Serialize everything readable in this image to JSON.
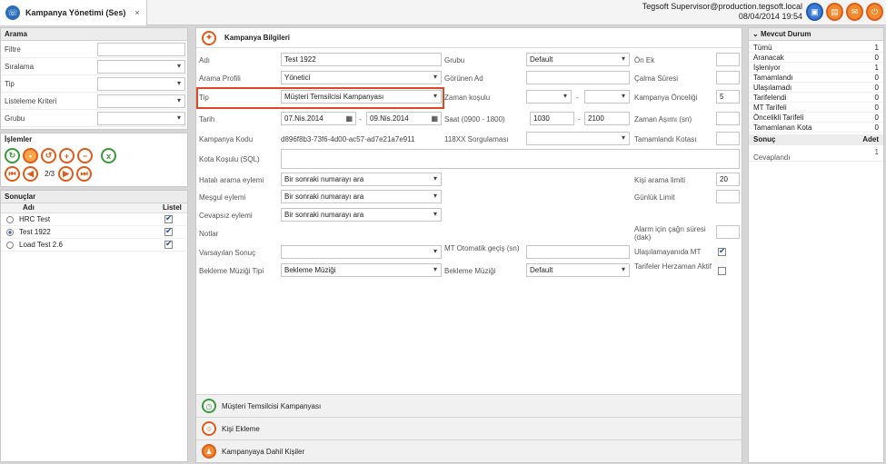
{
  "tab": {
    "title": "Kampanya Yönetimi (Ses)",
    "close": "×",
    "logo": "☏"
  },
  "user": {
    "name": "Tegsoft Supervisor@production.tegsoft.local",
    "datetime": "08/04/2014 19:54"
  },
  "arama": {
    "title": "Arama",
    "fields": [
      {
        "label": "Filtre",
        "value": ""
      },
      {
        "label": "Sıralama",
        "value": ""
      },
      {
        "label": "Tip",
        "value": ""
      },
      {
        "label": "Listeleme Kriteri",
        "value": ""
      },
      {
        "label": "Grubu",
        "value": ""
      }
    ]
  },
  "islemler": {
    "title": "İşlemler",
    "page": "2/3"
  },
  "sonuclar": {
    "title": "Sonuçlar",
    "col_name": "Adı",
    "col_list": "Listel",
    "items": [
      {
        "name": "HRC Test"
      },
      {
        "name": "Test 1922"
      },
      {
        "name": "Load Test 2.6"
      }
    ]
  },
  "kampanya": {
    "title": "Kampanya Bilgileri",
    "adi_label": "Adı",
    "adi": "Test 1922",
    "arama_profili_label": "Arama Profili",
    "arama_profili": "Yönetici",
    "tip_label": "Tip",
    "tip": "Müşteri Temsilcisi Kampanyası",
    "tarih_label": "Tarih",
    "tarih_start": "07.Nis.2014",
    "tarih_end": "09.Nis.2014",
    "dash": "-",
    "kod_label": "Kampanya Kodu",
    "kod": "d896f8b3-73f6-4d00-ac57-ad7e21a7e911",
    "kota_label": "Kota Koşulu (SQL)",
    "grubu_label": "Grubu",
    "grubu": "Default",
    "gorunen_label": "Görünen Ad",
    "zaman_label": "Zaman koşulu",
    "saat_label": "Saat (0900 - 1800)",
    "saat_start": "1030",
    "saat_end": "2100",
    "sorgu_label": "118XX Sorgulaması",
    "onek_label": "Ön Ek",
    "calma_label": "Çalma Süresi",
    "oncelik_label": "Kampanya Önceliği",
    "oncelik": "5",
    "asimi_label": "Zaman Aşımı (sn)",
    "tamam_kota_label": "Tamamlandı Kotası",
    "hatali_label": "Hatalı arama eylemi",
    "hatali": "Bir sonraki numarayı ara",
    "mesgul_label": "Meşgul eylemi",
    "mesgul": "Bir sonraki numarayı ara",
    "cevapsiz_label": "Cevapsız eylemi",
    "cevapsiz": "Bir sonraki numarayı ara",
    "notlar_label": "Notlar",
    "varsayilan_label": "Varsayılan Sonuç",
    "bekleme_tipi_label": "Bekleme Müziği Tipi",
    "bekleme_tipi": "Bekleme Müziği",
    "mt_oto_label": "MT Otomatik geçiş (sn)",
    "bekleme_label": "Bekleme Müziği",
    "bekleme": "Default",
    "kisi_limit_label": "Kişi arama limiti",
    "kisi_limit": "20",
    "gunluk_label": "Günlük Limit",
    "alarm_label": "Alarm için çağrı süresi (dak)",
    "ulasilamayan_label": "Ulaşılamayanıda MT",
    "tarifeler_label": "Tarifeler Herzaman Aktif"
  },
  "accordion": [
    "Müşteri Temsilcisi Kampanyası",
    "Kişi Ekleme",
    "Kampanyaya Dahil Kişiler"
  ],
  "mevcut": {
    "title": "Mevcut Durum",
    "rows": [
      {
        "label": "Tümü",
        "value": "1"
      },
      {
        "label": "Aranacak",
        "value": "0"
      },
      {
        "label": "İşleniyor",
        "value": "1"
      },
      {
        "label": "Tamamlandı",
        "value": "0"
      },
      {
        "label": "Ulaşılamadı",
        "value": "0"
      },
      {
        "label": "Tarifelendi",
        "value": "0"
      },
      {
        "label": "MT Tarifeli",
        "value": "0"
      },
      {
        "label": "Öncelikli Tarifeli",
        "value": "0"
      },
      {
        "label": "Tamamlanan Kota",
        "value": "0"
      }
    ],
    "sonuc_col": "Sonuç",
    "adet_col": "Adet",
    "sonuc_rows": [
      {
        "label": "Cevaplandı",
        "value": "1"
      }
    ]
  },
  "colors": {
    "accent": "#e05a1a",
    "highlight": "#e0452a"
  }
}
